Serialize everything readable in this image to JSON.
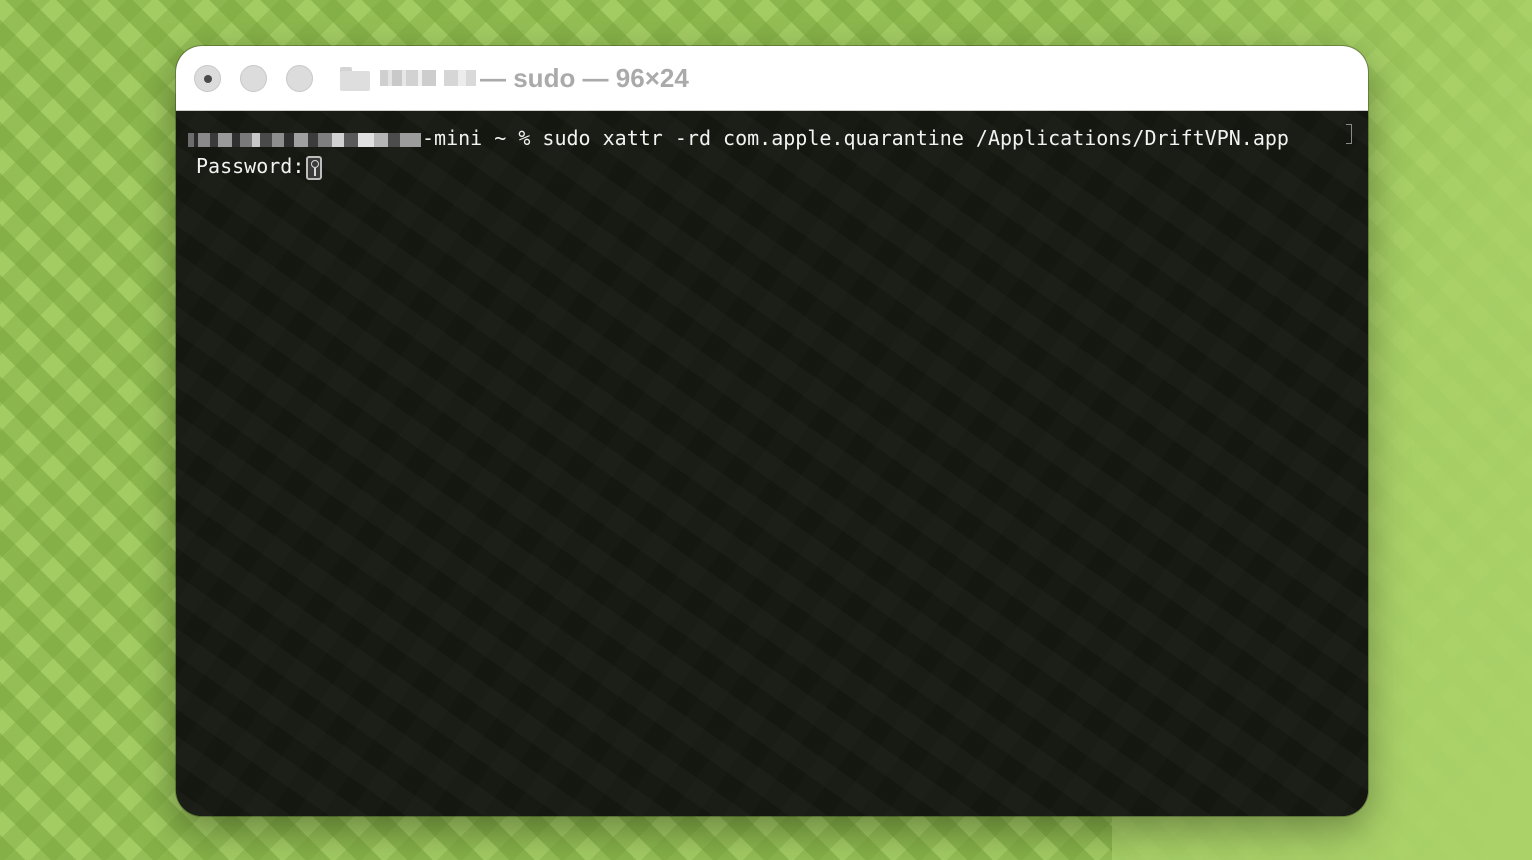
{
  "window": {
    "title": "— sudo — 96×24",
    "title_path_redacted": true
  },
  "terminal": {
    "prompt_suffix": "-mini ~ % ",
    "command": "sudo xattr -rd com.apple.quarantine /Applications/DriftVPN.app",
    "password_label": "Password:"
  },
  "icons": {
    "close": "close-button-icon",
    "minimize": "minimize-button-icon",
    "maximize": "zoom-button-icon",
    "folder": "folder-icon",
    "password": "key-icon"
  },
  "colors": {
    "desktop": "#a3cc63",
    "titlebar": "#ffffff",
    "terminal_bg": "#161a12",
    "terminal_text": "#f2f2f2",
    "title_text": "#aaaaaa"
  }
}
